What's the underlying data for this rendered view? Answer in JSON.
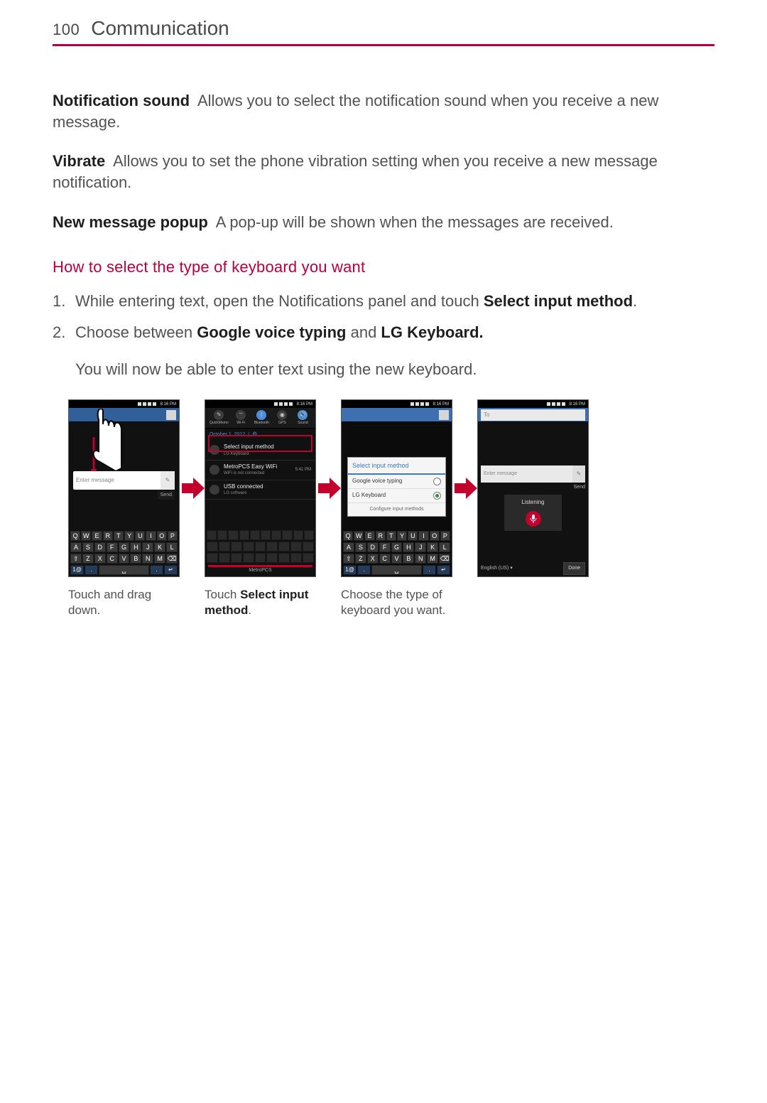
{
  "header": {
    "page_number": "100",
    "title": "Communication"
  },
  "settings": {
    "notification_sound": {
      "label": "Notification sound",
      "desc": "Allows you to select the notification sound when you receive a new message."
    },
    "vibrate": {
      "label": "Vibrate",
      "desc": "Allows you to set the phone vibration setting when you receive a new message notification."
    },
    "new_message_popup": {
      "label": "New message popup",
      "desc": "A pop-up will be shown when the messages are received."
    }
  },
  "section": {
    "title": "How to select the type of keyboard you want",
    "steps": {
      "s1_pre": "While entering text, open the Notifications panel and touch ",
      "s1_bold": "Select input method",
      "s1_post": ".",
      "s2_pre": "Choose between ",
      "s2_b1": "Google voice typing",
      "s2_mid": " and ",
      "s2_b2": "LG Keyboard.",
      "s2_after": "You will now be able to enter text using the new keyboard."
    }
  },
  "phone_common": {
    "clock": "8:16 PM",
    "compose_placeholder": "Enter message",
    "send": "Send",
    "kb_row1": [
      "Q",
      "W",
      "E",
      "R",
      "T",
      "Y",
      "U",
      "I",
      "O",
      "P"
    ],
    "kb_row2": [
      "A",
      "S",
      "D",
      "F",
      "G",
      "H",
      "J",
      "K",
      "L"
    ],
    "kb_row3": [
      "⇧",
      "Z",
      "X",
      "C",
      "V",
      "B",
      "N",
      "M",
      "⌫"
    ]
  },
  "shot2": {
    "quick_labels": [
      "QuickMemo",
      "Wi-Fi",
      "Bluetooth",
      "GPS",
      "Sound"
    ],
    "date": "October 1, 2012",
    "notif1_title": "Select input method",
    "notif1_sub": "LG Keyboard",
    "notif2_title": "MetroPCS Easy WiFi",
    "notif2_sub": "WiFi is not connected",
    "notif2_time": "5:41 PM",
    "notif3_title": "USB connected",
    "notif3_sub": "LG software",
    "carrier": "MetroPCS"
  },
  "shot3": {
    "dialog_title": "Select input method",
    "opt1": "Google voice typing",
    "opt2": "LG Keyboard",
    "configure": "Configure input methods"
  },
  "shot4": {
    "to": "To",
    "listening": "Listening",
    "lang": "English (US)",
    "done": "Done"
  },
  "captions": {
    "c1": "Touch and drag down.",
    "c2_pre": "Touch ",
    "c2_b": "Select input method",
    "c2_post": ".",
    "c3": "Choose the type of keyboard you want."
  }
}
